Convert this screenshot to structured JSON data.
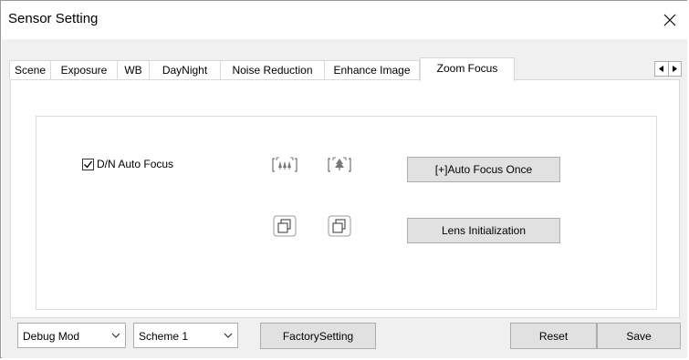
{
  "window": {
    "title": "Sensor Setting"
  },
  "tabs": [
    {
      "label": "Scene",
      "active": false
    },
    {
      "label": "Exposure",
      "active": false
    },
    {
      "label": "WB",
      "active": false
    },
    {
      "label": "DayNight",
      "active": false
    },
    {
      "label": "Noise Reduction",
      "active": false
    },
    {
      "label": "Enhance Image",
      "active": false
    },
    {
      "label": "Zoom Focus",
      "active": true
    }
  ],
  "zoom_focus": {
    "dn_auto_focus": {
      "label": "D/N Auto Focus",
      "checked": true
    },
    "auto_focus_once_label": "[+]Auto Focus Once",
    "lens_init_label": "Lens Initialization",
    "icons": [
      "zoom-wide-icon",
      "zoom-tele-icon",
      "window-restore-icon",
      "window-restore-icon"
    ]
  },
  "bottom": {
    "mode_select": {
      "value": "Debug Mod"
    },
    "scheme_select": {
      "value": "Scheme 1"
    },
    "factory_label": "FactorySetting",
    "reset_label": "Reset",
    "save_label": "Save"
  }
}
